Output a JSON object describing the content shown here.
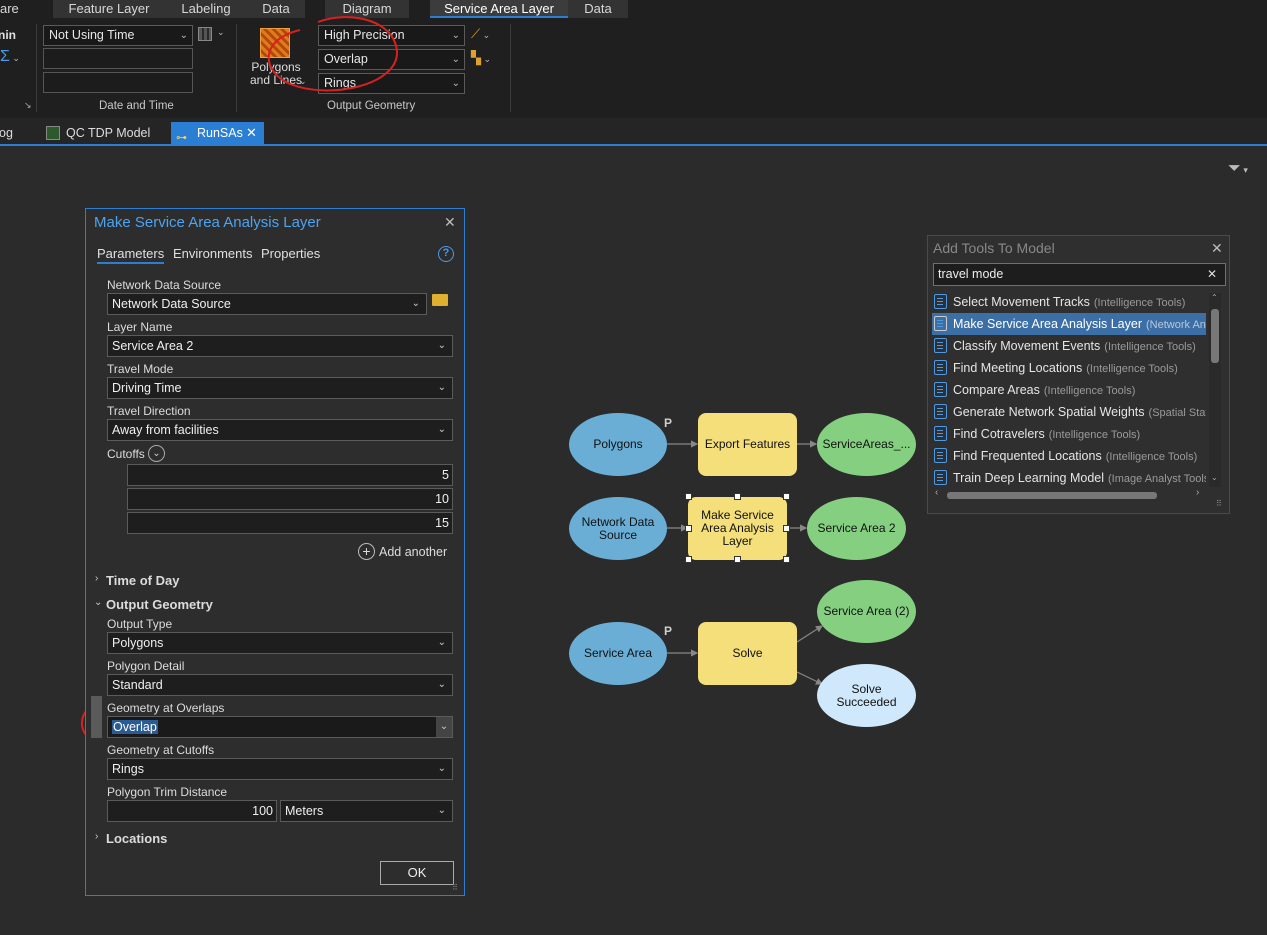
{
  "ribbon": {
    "tabs": [
      "are",
      "Feature Layer",
      "Labeling",
      "Data",
      "Diagram",
      "Service Area Layer",
      "Data"
    ],
    "partial_left": "nin",
    "time_mode": "Not Using Time",
    "date_time_group": "Date and Time",
    "polygons_lines": "Polygons and Lines",
    "precision": "High Precision",
    "overlap": "Overlap",
    "rings": "Rings",
    "output_geometry_group": "Output Geometry"
  },
  "doctabs": {
    "partial": "og",
    "qc_model": "QC TDP Model",
    "runsas": "RunSAs"
  },
  "dialog": {
    "title": "Make Service Area Analysis Layer",
    "tabs": {
      "parameters": "Parameters",
      "environments": "Environments",
      "properties": "Properties"
    },
    "network_data_source_label": "Network Data Source",
    "network_data_source_value": "Network Data Source",
    "layer_name_label": "Layer Name",
    "layer_name_value": "Service Area 2",
    "travel_mode_label": "Travel Mode",
    "travel_mode_value": "Driving Time",
    "travel_direction_label": "Travel Direction",
    "travel_direction_value": "Away from facilities",
    "cutoffs_label": "Cutoffs",
    "cutoffs": [
      "5",
      "10",
      "15"
    ],
    "add_another": "Add another",
    "time_of_day": "Time of Day",
    "output_geometry": "Output Geometry",
    "output_type_label": "Output Type",
    "output_type_value": "Polygons",
    "polygon_detail_label": "Polygon Detail",
    "polygon_detail_value": "Standard",
    "geometry_overlaps_label": "Geometry at Overlaps",
    "geometry_overlaps_value": "Overlap",
    "geometry_cutoffs_label": "Geometry at Cutoffs",
    "geometry_cutoffs_value": "Rings",
    "trim_label": "Polygon Trim Distance",
    "trim_value": "100",
    "trim_unit": "Meters",
    "locations": "Locations",
    "ok": "OK"
  },
  "model": {
    "polygons": "Polygons",
    "export_features": "Export Features",
    "service_areas_out": "ServiceAreas_...",
    "network_data_source": "Network Data Source",
    "make_sa": "Make Service Area Analysis Layer",
    "service_area_2": "Service Area 2",
    "service_area": "Service Area",
    "solve": "Solve",
    "service_area_paren": "Service Area (2)",
    "solve_succeeded": "Solve Succeeded",
    "p": "P"
  },
  "add_tools": {
    "title": "Add Tools To Model",
    "search": "travel mode",
    "items": [
      {
        "name": "Select Movement Tracks",
        "cat": "(Intelligence Tools)"
      },
      {
        "name": "Make Service Area Analysis Layer",
        "cat": "(Network Analys"
      },
      {
        "name": "Classify Movement Events",
        "cat": "(Intelligence Tools)"
      },
      {
        "name": "Find Meeting Locations",
        "cat": "(Intelligence Tools)"
      },
      {
        "name": "Compare Areas",
        "cat": "(Intelligence Tools)"
      },
      {
        "name": "Generate Network Spatial Weights",
        "cat": "(Spatial Statisti"
      },
      {
        "name": "Find Cotravelers",
        "cat": "(Intelligence Tools)"
      },
      {
        "name": "Find Frequented Locations",
        "cat": "(Intelligence Tools)"
      },
      {
        "name": "Train Deep Learning Model",
        "cat": "(Image Analyst Tools)"
      }
    ]
  },
  "colors": {
    "accent": "#2a7fd4",
    "annotation": "#d92020",
    "node_blue": "#6aaed6",
    "node_green": "#85d080",
    "node_yellow": "#f4df7a"
  }
}
